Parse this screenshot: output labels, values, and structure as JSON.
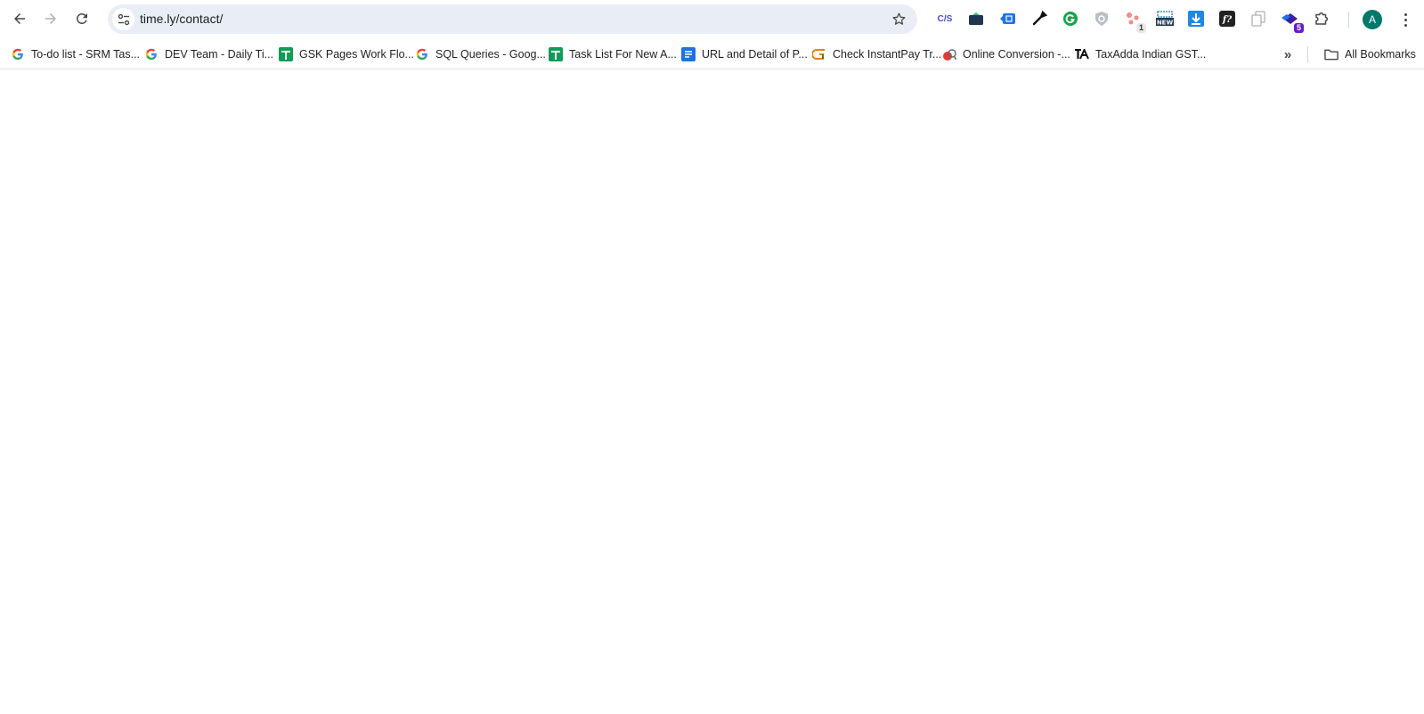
{
  "browser": {
    "url": "time.ly/contact/",
    "nav": {
      "back_icon": "arrow-left-icon",
      "forward_icon": "arrow-right-icon",
      "reload_icon": "reload-icon"
    },
    "extensions": [
      {
        "name": "css-ext",
        "label": "C/S"
      },
      {
        "name": "wallet-ext"
      },
      {
        "name": "translate-ext"
      },
      {
        "name": "color-picker-ext"
      },
      {
        "name": "grammarly-ext"
      },
      {
        "name": "shield-ext"
      },
      {
        "name": "network-ext",
        "badge": "1"
      },
      {
        "name": "new-ext",
        "label": "NEW"
      },
      {
        "name": "download-ext"
      },
      {
        "name": "font-ext",
        "label": "f?"
      },
      {
        "name": "copy-ext"
      },
      {
        "name": "layers-ext",
        "badge": "5"
      },
      {
        "name": "extensions-puzzle"
      }
    ],
    "profile_initial": "A",
    "colors": {
      "omnibox_bg": "#e9eef6",
      "avatar_bg": "#00796b",
      "badge_purple": "#6a1bcc"
    }
  },
  "bookmarks": {
    "items": [
      {
        "label": "To-do list - SRM Tas...",
        "icon": "google-icon"
      },
      {
        "label": "DEV Team - Daily Ti...",
        "icon": "google-icon"
      },
      {
        "label": "GSK Pages Work Flo...",
        "icon": "sheets-icon"
      },
      {
        "label": "SQL Queries - Goog...",
        "icon": "google-icon"
      },
      {
        "label": "Task List For New A...",
        "icon": "sheets-icon"
      },
      {
        "label": "URL and Detail of P...",
        "icon": "docs-icon"
      },
      {
        "label": "Check InstantPay Tr...",
        "icon": "instantpay-icon"
      },
      {
        "label": "Online Conversion -...",
        "icon": "conversion-icon"
      },
      {
        "label": "TaxAdda Indian GST...",
        "icon": "taxadda-icon"
      }
    ],
    "overflow_label": "»",
    "all_bookmarks_label": "All Bookmarks"
  }
}
